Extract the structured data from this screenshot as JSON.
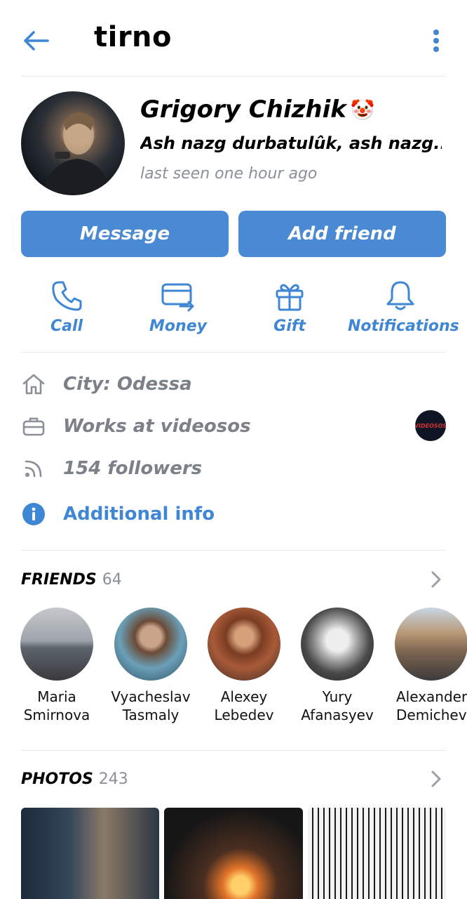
{
  "header": {
    "title": "tirno",
    "back_icon": "arrow-left-icon",
    "more_icon": "more-vertical-icon"
  },
  "profile": {
    "name": "Grigory Chizhik",
    "name_emoji": "🤡",
    "status": "Ash nazg durbatulûk, ash nazg...",
    "last_seen": "last seen one hour ago"
  },
  "buttons": {
    "message": "Message",
    "add_friend": "Add friend"
  },
  "actions": [
    {
      "label": "Call",
      "icon": "phone-icon"
    },
    {
      "label": "Money",
      "icon": "money-transfer-icon"
    },
    {
      "label": "Gift",
      "icon": "gift-icon"
    },
    {
      "label": "Notifications",
      "icon": "bell-icon"
    }
  ],
  "info": {
    "city": "City: Odessa",
    "work": "Works at videosos",
    "company_logo_text": "VIDEOSOS",
    "followers": "154 followers",
    "additional": "Additional info"
  },
  "friends": {
    "title": "FRIENDS",
    "count": "64",
    "items": [
      {
        "first": "Maria",
        "last": "Smirnova"
      },
      {
        "first": "Vyacheslav",
        "last": "Tasmaly"
      },
      {
        "first": "Alexey",
        "last": "Lebedev"
      },
      {
        "first": "Yury",
        "last": "Afanasyev"
      },
      {
        "first": "Alexander",
        "last": "Demichev"
      }
    ]
  },
  "photos": {
    "title": "PHOTOS",
    "count": "243"
  },
  "colors": {
    "accent": "#4a8ad4",
    "accent_text": "#3f86d4",
    "muted": "#8a8f98",
    "divider": "#e9eaec"
  }
}
